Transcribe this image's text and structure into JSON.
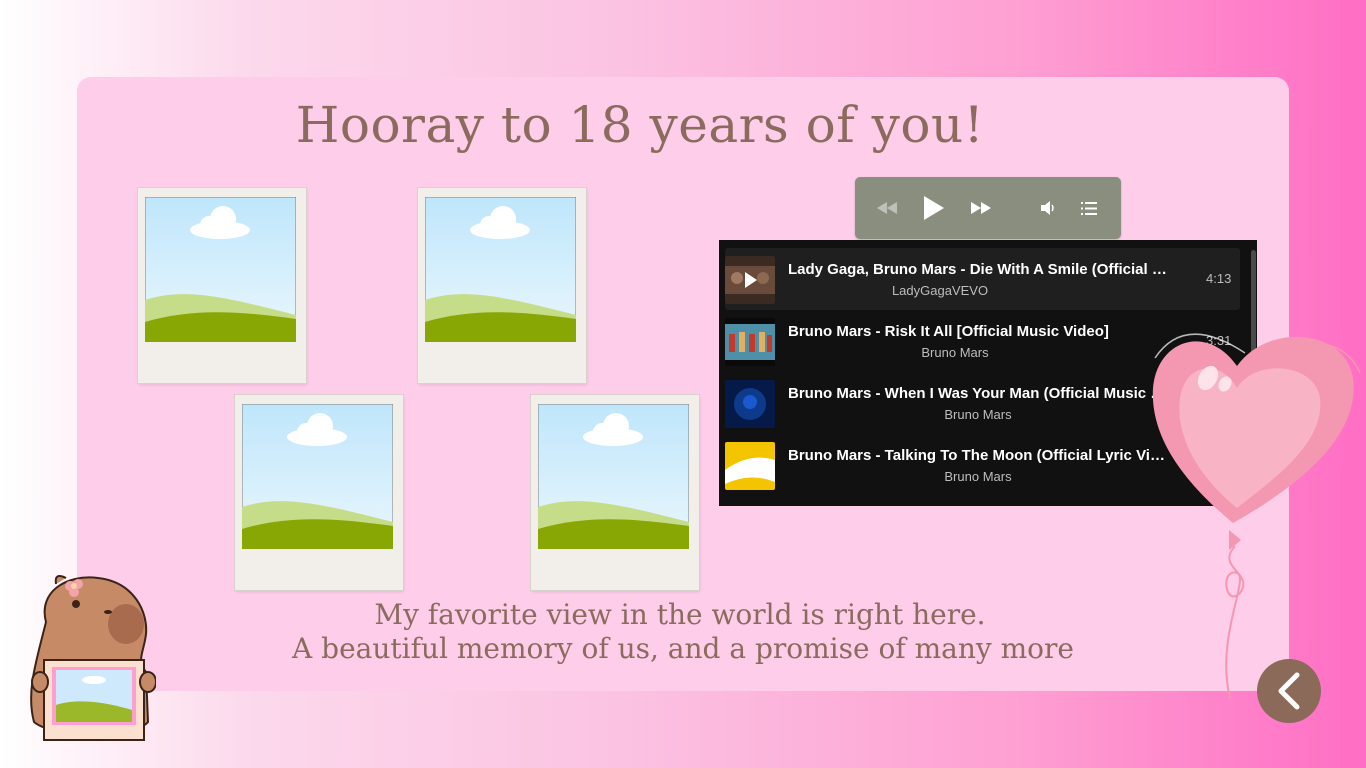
{
  "page": {
    "title": "Hooray to 18 years of you!",
    "caption_line1": "My favorite view in the world is right here.",
    "caption_line2": "A beautiful memory of us, and a promise of many more"
  },
  "photos": [
    {
      "label": "photo-placeholder-1"
    },
    {
      "label": "photo-placeholder-2"
    },
    {
      "label": "photo-placeholder-3"
    },
    {
      "label": "photo-placeholder-4"
    }
  ],
  "player": {
    "controls": [
      "rewind-icon",
      "play-icon",
      "fast-forward-icon",
      "volume-icon",
      "playlist-icon"
    ],
    "tracks": [
      {
        "title": "Lady Gaga, Bruno Mars - Die With A Smile (Official Music Video)",
        "artist": "LadyGagaVEVO",
        "duration": "4:13",
        "active": true
      },
      {
        "title": "Bruno Mars - Risk It All [Official Music Video]",
        "artist": "Bruno Mars",
        "duration": "3:31",
        "active": false
      },
      {
        "title": "Bruno Mars - When I Was Your Man (Official Music Video)",
        "artist": "Bruno Mars",
        "duration": "",
        "active": false
      },
      {
        "title": "Bruno Mars - Talking To The Moon (Official Lyric Video)",
        "artist": "Bruno Mars",
        "duration": "",
        "active": false
      }
    ]
  },
  "decor": {
    "heart": "heart-balloon-icon",
    "mascot": "capybara-with-photo-icon"
  },
  "nav": {
    "back": "chevron-left-icon"
  },
  "colors": {
    "text_brown": "#8b6b5d",
    "card_pink": "#fdcdea",
    "player_gray": "#8a8e7f",
    "back_button": "#8b6a5a"
  }
}
